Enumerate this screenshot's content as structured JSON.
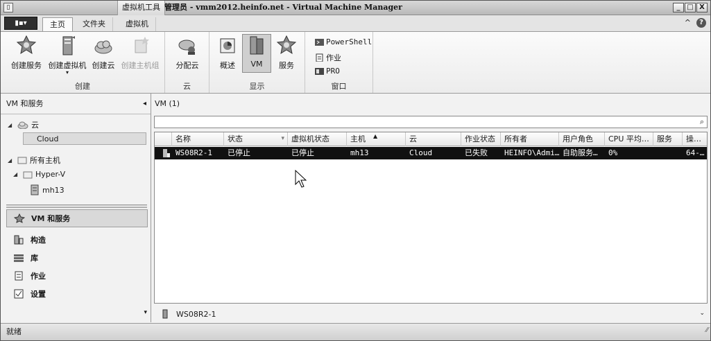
{
  "title": {
    "system_icon": "▯",
    "context_tab": "虚拟机工具",
    "text": "管理员 - vmm2012.heinfo.net - Virtual Machine Manager",
    "minimize": "_",
    "maximize": "□",
    "close": "X"
  },
  "tabs": {
    "app_button": "▮▪▾",
    "home": "主页",
    "folder": "文件夹",
    "vm": "虚拟机",
    "collapse": "^",
    "help": "?"
  },
  "ribbon": {
    "create_service": "创建服务",
    "create_vm": "创建虚拟机",
    "create_vm_arrow": "▾",
    "create_cloud": "创建云",
    "create_host_group": "创建主机组",
    "group_create": "创建",
    "assign_cloud": "分配云",
    "group_cloud": "云",
    "overview": "概述",
    "vm_view": "VM",
    "service_view": "服务",
    "group_show": "显示",
    "powershell": "PowerShell",
    "jobs": "作业",
    "pro": "PRO",
    "group_window": "窗口"
  },
  "left_nav": {
    "header": "VM 和服务",
    "collapse_chevron": "◂",
    "tree": {
      "clouds": "云",
      "cloud_item": "Cloud",
      "all_hosts": "所有主机",
      "hyperv": "Hyper-V",
      "host": "mh13"
    },
    "workspaces": {
      "vms_services": "VM 和服务",
      "fabric": "构造",
      "library": "库",
      "jobs": "作业",
      "settings": "设置"
    },
    "expand_chevron": "▾"
  },
  "main": {
    "header": "VM (1)",
    "search_icon": "⌕",
    "columns": [
      "名称",
      "状态",
      "虚拟机状态",
      "主机",
      "云",
      "作业状态",
      "所有者",
      "用户角色",
      "CPU 平均…",
      "服务",
      "操…"
    ],
    "sort_indicator": "▲",
    "filter_indicator": "▾",
    "rows": [
      [
        "WS08R2-1",
        "已停止",
        "已停止",
        "mh13",
        "Cloud",
        "已失败",
        "HEINFO\\Admi…",
        "自助服务…",
        "0%",
        "",
        "64-…"
      ]
    ],
    "detail_name": "WS08R2-1",
    "detail_chevron": "⌄"
  },
  "status": {
    "text": "就绪",
    "grip": "⁄⁄"
  },
  "colors": {
    "selected_row": "#111111",
    "window_bg": "#f0f0f0"
  }
}
